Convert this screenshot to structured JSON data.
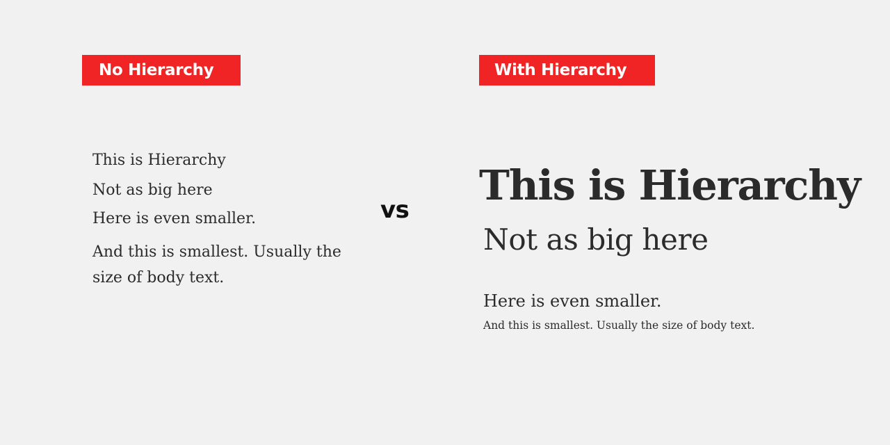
{
  "left_panel": {
    "badge": "No Hierarchy",
    "lines": {
      "line1": "This is Hierarchy",
      "line2": "Not as big here",
      "line3": "Here is even smaller.",
      "line4": "And this is smallest. Usually the size of body text."
    }
  },
  "separator": "vs",
  "right_panel": {
    "badge": "With Hierarchy",
    "lines": {
      "heading1": "This is Hierarchy",
      "heading2": "Not as big here",
      "heading3": "Here is even smaller.",
      "body": "And this is smallest. Usually the size of body text."
    }
  },
  "colors": {
    "background": "#f1f1f1",
    "badge": "#f02424",
    "text": "#2b2b2b"
  }
}
